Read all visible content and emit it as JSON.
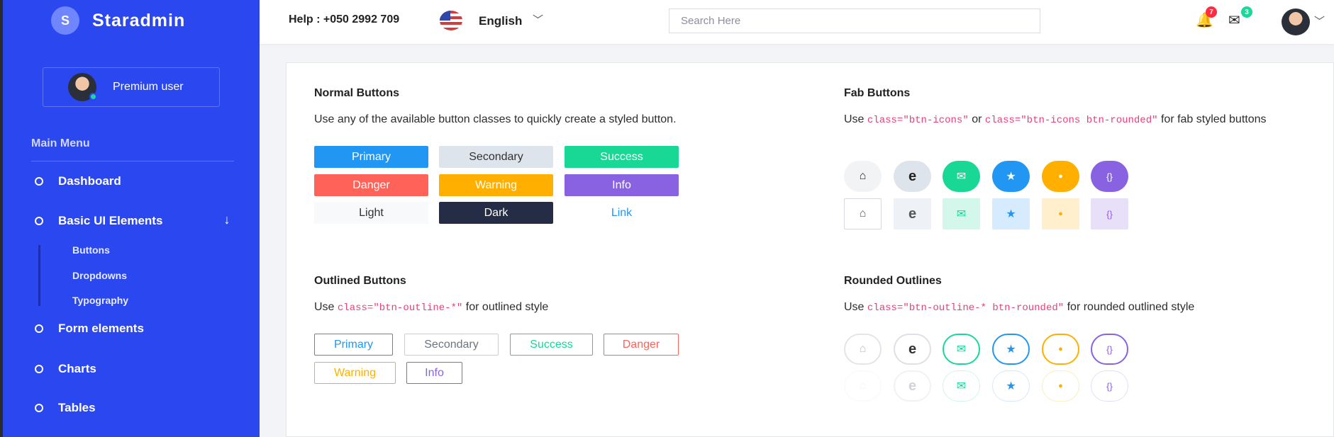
{
  "brand": {
    "letter": "S",
    "name": "Staradmin"
  },
  "user": {
    "label": "Premium user"
  },
  "sidebar": {
    "menu_title": "Main Menu",
    "items": [
      {
        "label": "Dashboard"
      },
      {
        "label": "Basic UI Elements"
      },
      {
        "label": "Form elements"
      },
      {
        "label": "Charts"
      },
      {
        "label": "Tables"
      }
    ],
    "sub_items": [
      {
        "label": "Buttons"
      },
      {
        "label": "Dropdowns"
      },
      {
        "label": "Typography"
      }
    ]
  },
  "topbar": {
    "help": "Help : +050 2992 709",
    "language": "English",
    "search_placeholder": "Search Here",
    "notifications_count": "7",
    "messages_count": "3"
  },
  "normal": {
    "title": "Normal Buttons",
    "desc": "Use any of the available button classes to quickly create a styled button.",
    "buttons": [
      "Primary",
      "Secondary",
      "Success",
      "Danger",
      "Warning",
      "Info",
      "Light",
      "Dark",
      "Link"
    ]
  },
  "fab": {
    "title": "Fab Buttons",
    "desc_use": "Use",
    "code1": "class=\"btn-icons\"",
    "desc_or": "or",
    "code2": "class=\"btn-icons btn-rounded\"",
    "desc_end": "for fab styled buttons"
  },
  "outlined": {
    "title": "Outlined Buttons",
    "desc_use": "Use",
    "code": "class=\"btn-outline-*\"",
    "desc_end": "for outlined style",
    "buttons": [
      "Primary",
      "Secondary",
      "Success",
      "Danger",
      "Warning",
      "Info"
    ]
  },
  "rounded": {
    "title": "Rounded Outlines",
    "desc_use": "Use",
    "code": "class=\"btn-outline-* btn-rounded\"",
    "desc_end": "for rounded outlined style"
  },
  "icons": {
    "home": "⌂",
    "edge": "e",
    "mail": "✉",
    "star": "★",
    "pin": "●",
    "braces": "{}"
  },
  "colors": {
    "primary": "#2196f3",
    "secondary": "#dde4eb",
    "success": "#19d895",
    "danger": "#ff6258",
    "warning": "#ffaf00",
    "info": "#8862e0",
    "light": "#f8f9fa",
    "dark": "#252c46",
    "sidebar": "#2a47f0"
  }
}
